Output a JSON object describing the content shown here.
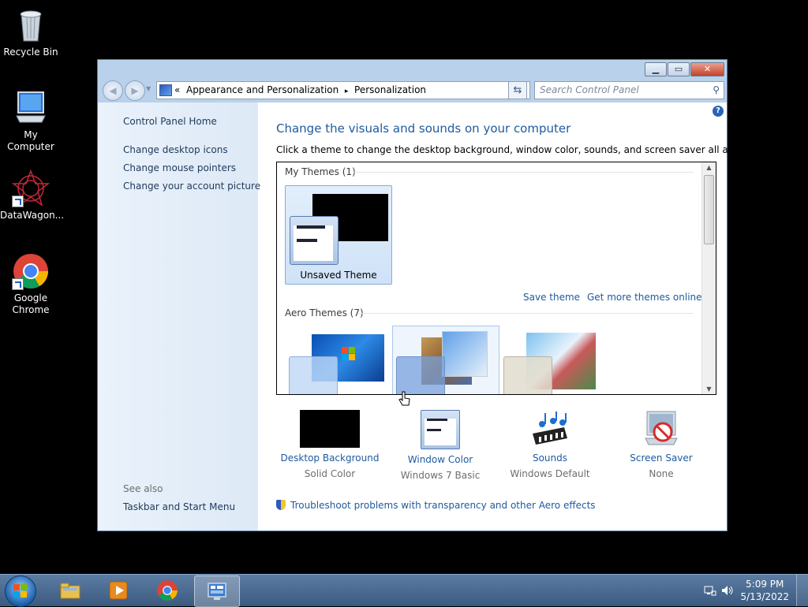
{
  "desktop": {
    "icons": [
      {
        "label": "Recycle Bin",
        "icon": "recycle-bin-icon"
      },
      {
        "label": "My Computer",
        "icon": "computer-icon"
      },
      {
        "label": "DataWagon...",
        "icon": "datawagon-icon"
      },
      {
        "label": "Google Chrome",
        "icon": "chrome-icon"
      }
    ]
  },
  "window": {
    "address": {
      "crumb_prefix": "«",
      "crumb1": "Appearance and Personalization",
      "separator": "▸",
      "crumb2": "Personalization"
    },
    "search_placeholder": "Search Control Panel",
    "left_pane": {
      "home": "Control Panel Home",
      "links": [
        "Change desktop icons",
        "Change mouse pointers",
        "Change your account picture"
      ],
      "see_also": "See also",
      "see_also_links": [
        "Taskbar and Start Menu"
      ]
    },
    "main": {
      "title": "Change the visuals and sounds on your computer",
      "subtitle": "Click a theme to change the desktop background, window color, sounds, and screen saver all at once.",
      "my_themes_header": "My Themes (1)",
      "unsaved_theme": "Unsaved Theme",
      "save_theme": "Save theme",
      "get_more": "Get more themes online",
      "aero_header": "Aero Themes (7)"
    },
    "bottom": [
      {
        "name": "Desktop Background",
        "value": "Solid Color",
        "icon": "desktop-background-icon"
      },
      {
        "name": "Window Color",
        "value": "Windows 7 Basic",
        "icon": "window-color-icon"
      },
      {
        "name": "Sounds",
        "value": "Windows Default",
        "icon": "sounds-icon"
      },
      {
        "name": "Screen Saver",
        "value": "None",
        "icon": "screen-saver-icon"
      }
    ],
    "troubleshoot": "Troubleshoot problems with transparency and other Aero effects"
  },
  "taskbar": {
    "time": "5:09 PM",
    "date": "5/13/2022",
    "apps": [
      "file-explorer-icon",
      "media-player-icon",
      "chrome-icon",
      "control-panel-icon"
    ]
  }
}
